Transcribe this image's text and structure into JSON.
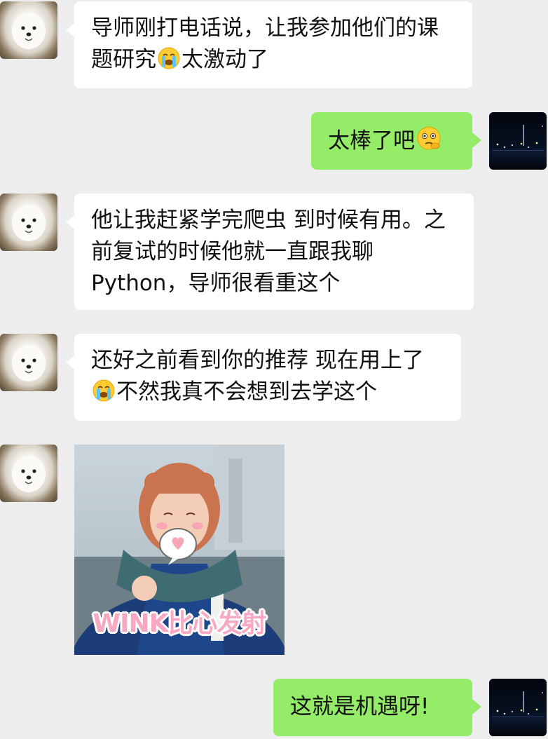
{
  "messages": [
    {
      "sender": "contact",
      "text_before": "导师刚打电话说，让我参加他们的课题研究",
      "emoji": "crying-face",
      "text_after": "太激动了"
    },
    {
      "sender": "self",
      "text_before": "太棒了吧",
      "emoji": "thinking-face",
      "text_after": ""
    },
    {
      "sender": "contact",
      "text": "他让我赶紧学完爬虫 到时候有用。之前复试的时候他就一直跟我聊Python，导师很看重这个"
    },
    {
      "sender": "contact",
      "text_before": "还好之前看到你的推荐 现在用上了",
      "emoji": "crying-face",
      "text_after": "不然我真不会想到去学这个"
    },
    {
      "sender": "contact",
      "type": "sticker",
      "caption": "WINK比心发射"
    },
    {
      "sender": "self",
      "text": "这就是机遇呀!"
    }
  ],
  "colors": {
    "background": "#ededed",
    "incoming_bubble": "#ffffff",
    "outgoing_bubble": "#95ec69",
    "sticker_caption": "#f7a9c4"
  }
}
